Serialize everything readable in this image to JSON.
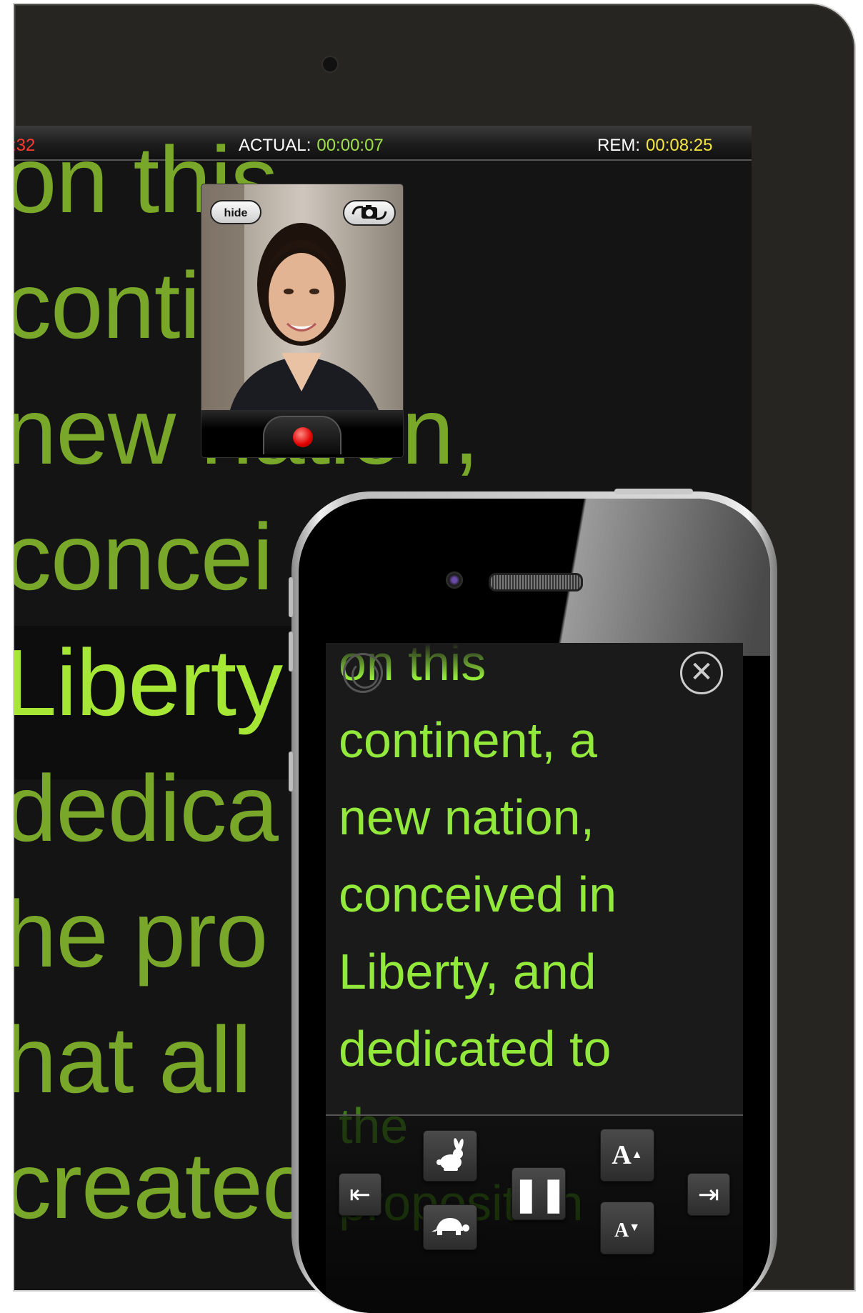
{
  "ipad": {
    "timer_bar": {
      "left_value": ":32",
      "actual_label": "ACTUAL:",
      "actual_value": "00:00:07",
      "rem_label": "REM:",
      "rem_value": "00:08:25"
    },
    "script_lines": [
      "on this",
      "conti",
      "new nation,",
      "concei",
      "Liberty",
      "dedica",
      "he pro",
      "hat all",
      "createc"
    ],
    "camera_preview": {
      "hide_label": "hide",
      "flip_icon": "camera-flip-icon",
      "record_icon": "record-dot-icon"
    }
  },
  "iphone": {
    "script_lines": [
      "on this",
      "continent, a",
      "new nation,",
      "conceived in",
      "Liberty, and",
      "dedicated to",
      "the",
      "proposition"
    ],
    "overlay_icons": {
      "left": "loop-icon",
      "right": "close-icon"
    },
    "controls": {
      "start": "⇤",
      "faster_icon": "rabbit-icon",
      "pause": "❚❚",
      "font_up": "A",
      "font_up_arrow": "▲",
      "end": "⇥",
      "slower_icon": "turtle-icon",
      "font_down": "A",
      "font_down_arrow": "▼"
    }
  },
  "colors": {
    "script_green": "#79a72a",
    "highlight_green": "#a6e635",
    "phone_green": "#93e83c",
    "actual_green": "#9ee04a",
    "rem_yellow": "#f5e542",
    "left_red": "#ff3b30"
  }
}
